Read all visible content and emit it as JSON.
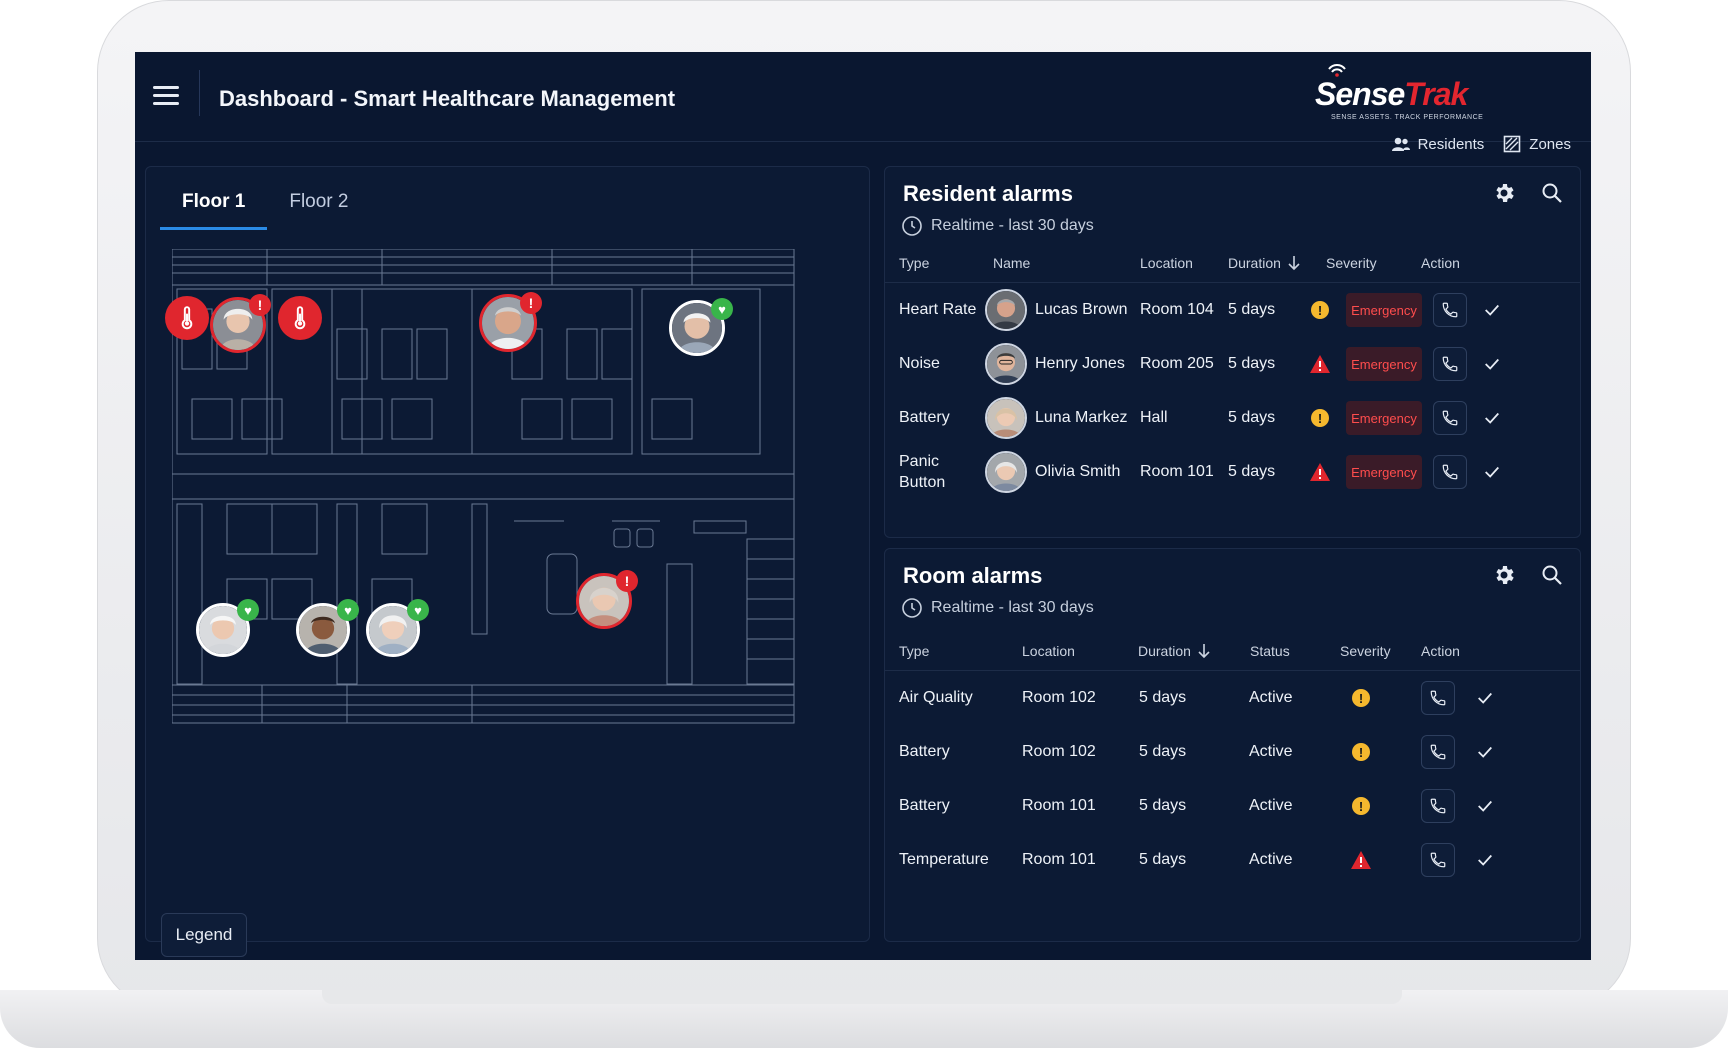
{
  "header": {
    "title": "Dashboard - Smart Healthcare Management",
    "logo_word_1": "Sense",
    "logo_word_2": "Trak",
    "logo_tagline": "SENSE ASSETS. TRACK PERFORMANCE",
    "links": [
      {
        "label": "Residents",
        "icon": "residents-icon"
      },
      {
        "label": "Zones",
        "icon": "zones-icon"
      }
    ]
  },
  "map": {
    "tabs": [
      {
        "label": "Floor 1",
        "active": true
      },
      {
        "label": "Floor 2",
        "active": false
      }
    ],
    "legend_label": "Legend"
  },
  "resident_alarms": {
    "title": "Resident alarms",
    "subtitle": "Realtime - last 30 days",
    "columns": [
      "Type",
      "Name",
      "Location",
      "Duration",
      "Severity",
      "Action"
    ],
    "rows": [
      {
        "type": "Heart Rate",
        "name": "Lucas Brown",
        "location": "Room 104",
        "duration": "5 days",
        "severity": "warning",
        "badge": "Emergency"
      },
      {
        "type": "Noise",
        "name": "Henry Jones",
        "location": "Room 205",
        "duration": "5 days",
        "severity": "critical",
        "badge": "Emergency"
      },
      {
        "type": "Battery",
        "name": "Luna Markez",
        "location": "Hall",
        "duration": "5 days",
        "severity": "warning",
        "badge": "Emergency"
      },
      {
        "type": "Panic Button",
        "name": "Olivia Smith",
        "location": "Room 101",
        "duration": "5 days",
        "severity": "critical",
        "badge": "Emergency"
      }
    ]
  },
  "room_alarms": {
    "title": "Room alarms",
    "subtitle": "Realtime - last 30 days",
    "columns": [
      "Type",
      "Location",
      "Duration",
      "Status",
      "Severity",
      "Action"
    ],
    "rows": [
      {
        "type": "Air Quality",
        "location": "Room 102",
        "duration": "5 days",
        "status": "Active",
        "severity": "warning"
      },
      {
        "type": "Battery",
        "location": "Room 102",
        "duration": "5 days",
        "status": "Active",
        "severity": "warning"
      },
      {
        "type": "Battery",
        "location": "Room 101",
        "duration": "5 days",
        "status": "Active",
        "severity": "warning"
      },
      {
        "type": "Temperature",
        "location": "Room 101",
        "duration": "5 days",
        "status": "Active",
        "severity": "critical"
      }
    ]
  },
  "colors": {
    "background": "#0a1730",
    "alert": "#e0262e",
    "ok": "#39b54a",
    "warning": "#f5b82e",
    "accent": "#2b8be6"
  }
}
